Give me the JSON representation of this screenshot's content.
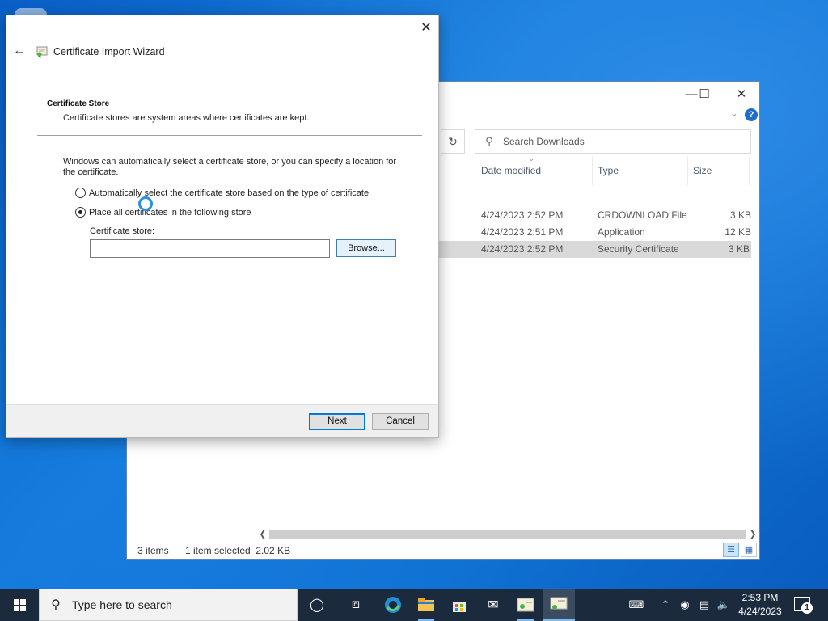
{
  "explorer": {
    "search_placeholder": "Search Downloads",
    "columns": [
      "Date modified",
      "Type",
      "Size"
    ],
    "rows": [
      {
        "date": "4/24/2023 2:52 PM",
        "type": "CRDOWNLOAD File",
        "size": "3 KB",
        "selected": false
      },
      {
        "date": "4/24/2023 2:51 PM",
        "type": "Application",
        "size": "12 KB",
        "selected": false
      },
      {
        "date": "4/24/2023 2:52 PM",
        "type": "Security Certificate",
        "size": "3 KB",
        "selected": true
      }
    ],
    "status": {
      "items": "3 items",
      "selected": "1 item selected  2.02 KB"
    },
    "help_label": "?"
  },
  "wizard": {
    "title": "Certificate Import Wizard",
    "heading": "Certificate Store",
    "subheading": "Certificate stores are system areas where certificates are kept.",
    "description": "Windows can automatically select a certificate store, or you can specify a location for the certificate.",
    "radio_auto": "Automatically select the certificate store based on the type of certificate",
    "radio_manual": "Place all certificates in the following store",
    "selected_option": "manual",
    "store_label": "Certificate store:",
    "store_value": "",
    "browse": "Browse...",
    "next": "Next",
    "cancel": "Cancel"
  },
  "taskbar": {
    "search_placeholder": "Type here to search",
    "time": "2:53 PM",
    "date": "4/24/2023",
    "notification_count": "1",
    "accent_color": "#0078d7"
  }
}
